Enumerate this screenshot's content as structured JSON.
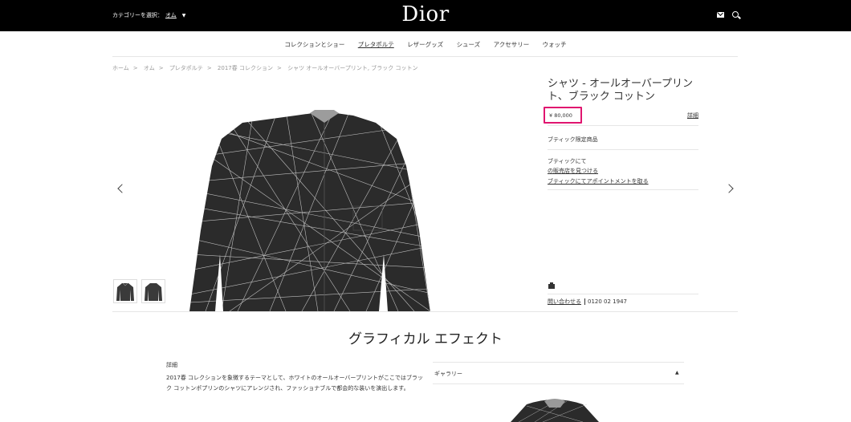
{
  "header": {
    "category_label": "カテゴリーを選択：",
    "category_value": "オム",
    "logo": "Dior"
  },
  "nav": {
    "items": [
      "コレクションとショー",
      "プレタポルテ",
      "レザーグッズ",
      "シューズ",
      "アクセサリー",
      "ウォッチ"
    ],
    "active": "プレタポルテ"
  },
  "breadcrumb": [
    "ホーム",
    "オム",
    "プレタポルテ",
    "2017春 コレクション",
    "シャツ オールオーバープリント, ブラック コットン"
  ],
  "product": {
    "title": "シャツ - オールオーバープリント、ブラック コットン",
    "price": "¥ 80,000",
    "detail_link": "詳細",
    "boutique_only": "ブティック限定商品",
    "boutique_title": "ブティックにて",
    "find_store": "の販売店を見つける",
    "appointment": "ブティックにてアポイントメントを取る",
    "contact_link": "問い合わせる",
    "phone": "0120 02 1947"
  },
  "section": {
    "title": "グラフィカル エフェクト",
    "detail_label": "詳細",
    "description": "2017春 コレクションを象徴するテーマとして、ホワイトのオールオーバープリントがここではブラック コットンポプリンのシャツにアレンジされ、ファッショナブルで都会的な装いを演出します。",
    "gallery_label": "ギャラリー"
  },
  "icons": {
    "mail": "mail-icon",
    "search": "search-icon",
    "prev": "chevron-left-icon",
    "next": "chevron-right-icon",
    "print": "print-icon",
    "gallery_toggle": "caret-up-icon",
    "category_caret": "caret-down-icon"
  },
  "colors": {
    "topbar": "#000000",
    "highlight": "#e0156f",
    "shirt": "#2b2b2b"
  }
}
